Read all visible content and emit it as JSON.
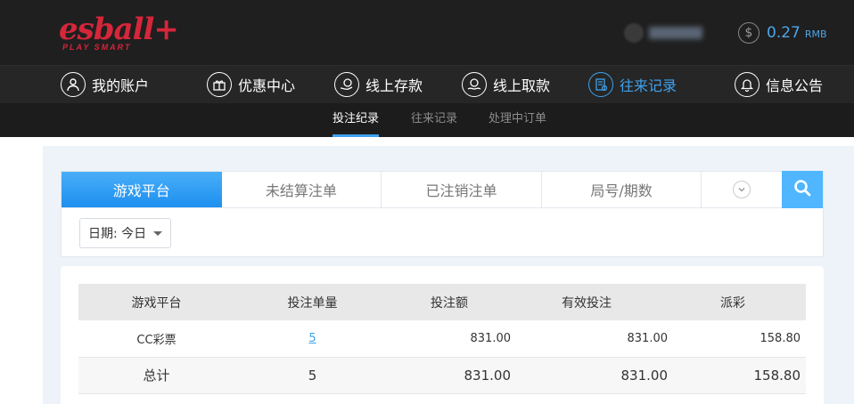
{
  "header": {
    "logo_text": "esball+",
    "logo_sub": "PLAY SMART",
    "balance_value": "0.27",
    "balance_unit": "RMB",
    "balance_icon": "dollar-coin-icon"
  },
  "main_nav": [
    {
      "label": "我的账户",
      "icon": "user-icon"
    },
    {
      "label": "优惠中心",
      "icon": "gift-icon"
    },
    {
      "label": "线上存款",
      "icon": "deposit-icon"
    },
    {
      "label": "线上取款",
      "icon": "withdraw-icon"
    },
    {
      "label": "往来记录",
      "icon": "records-icon",
      "active": true
    },
    {
      "label": "信息公告",
      "icon": "bell-icon"
    }
  ],
  "sub_nav": [
    {
      "label": "投注纪录",
      "active": true
    },
    {
      "label": "往来记录"
    },
    {
      "label": "处理中订单"
    }
  ],
  "tabs": [
    {
      "label": "游戏平台",
      "active": true
    },
    {
      "label": "未结算注单"
    },
    {
      "label": "已注销注单"
    },
    {
      "label": "局号/期数"
    }
  ],
  "filter": {
    "date_label": "日期: 今日"
  },
  "table": {
    "headers": [
      "游戏平台",
      "投注单量",
      "投注额",
      "有效投注",
      "派彩"
    ],
    "rows": [
      [
        "CC彩票",
        "5",
        "831.00",
        "831.00",
        "158.80"
      ]
    ],
    "total": [
      "总计",
      "5",
      "831.00",
      "831.00",
      "158.80"
    ]
  },
  "colors": {
    "accent": "#3ea2ee",
    "brand": "#d5263a",
    "topbar": "#1f1f1f"
  }
}
